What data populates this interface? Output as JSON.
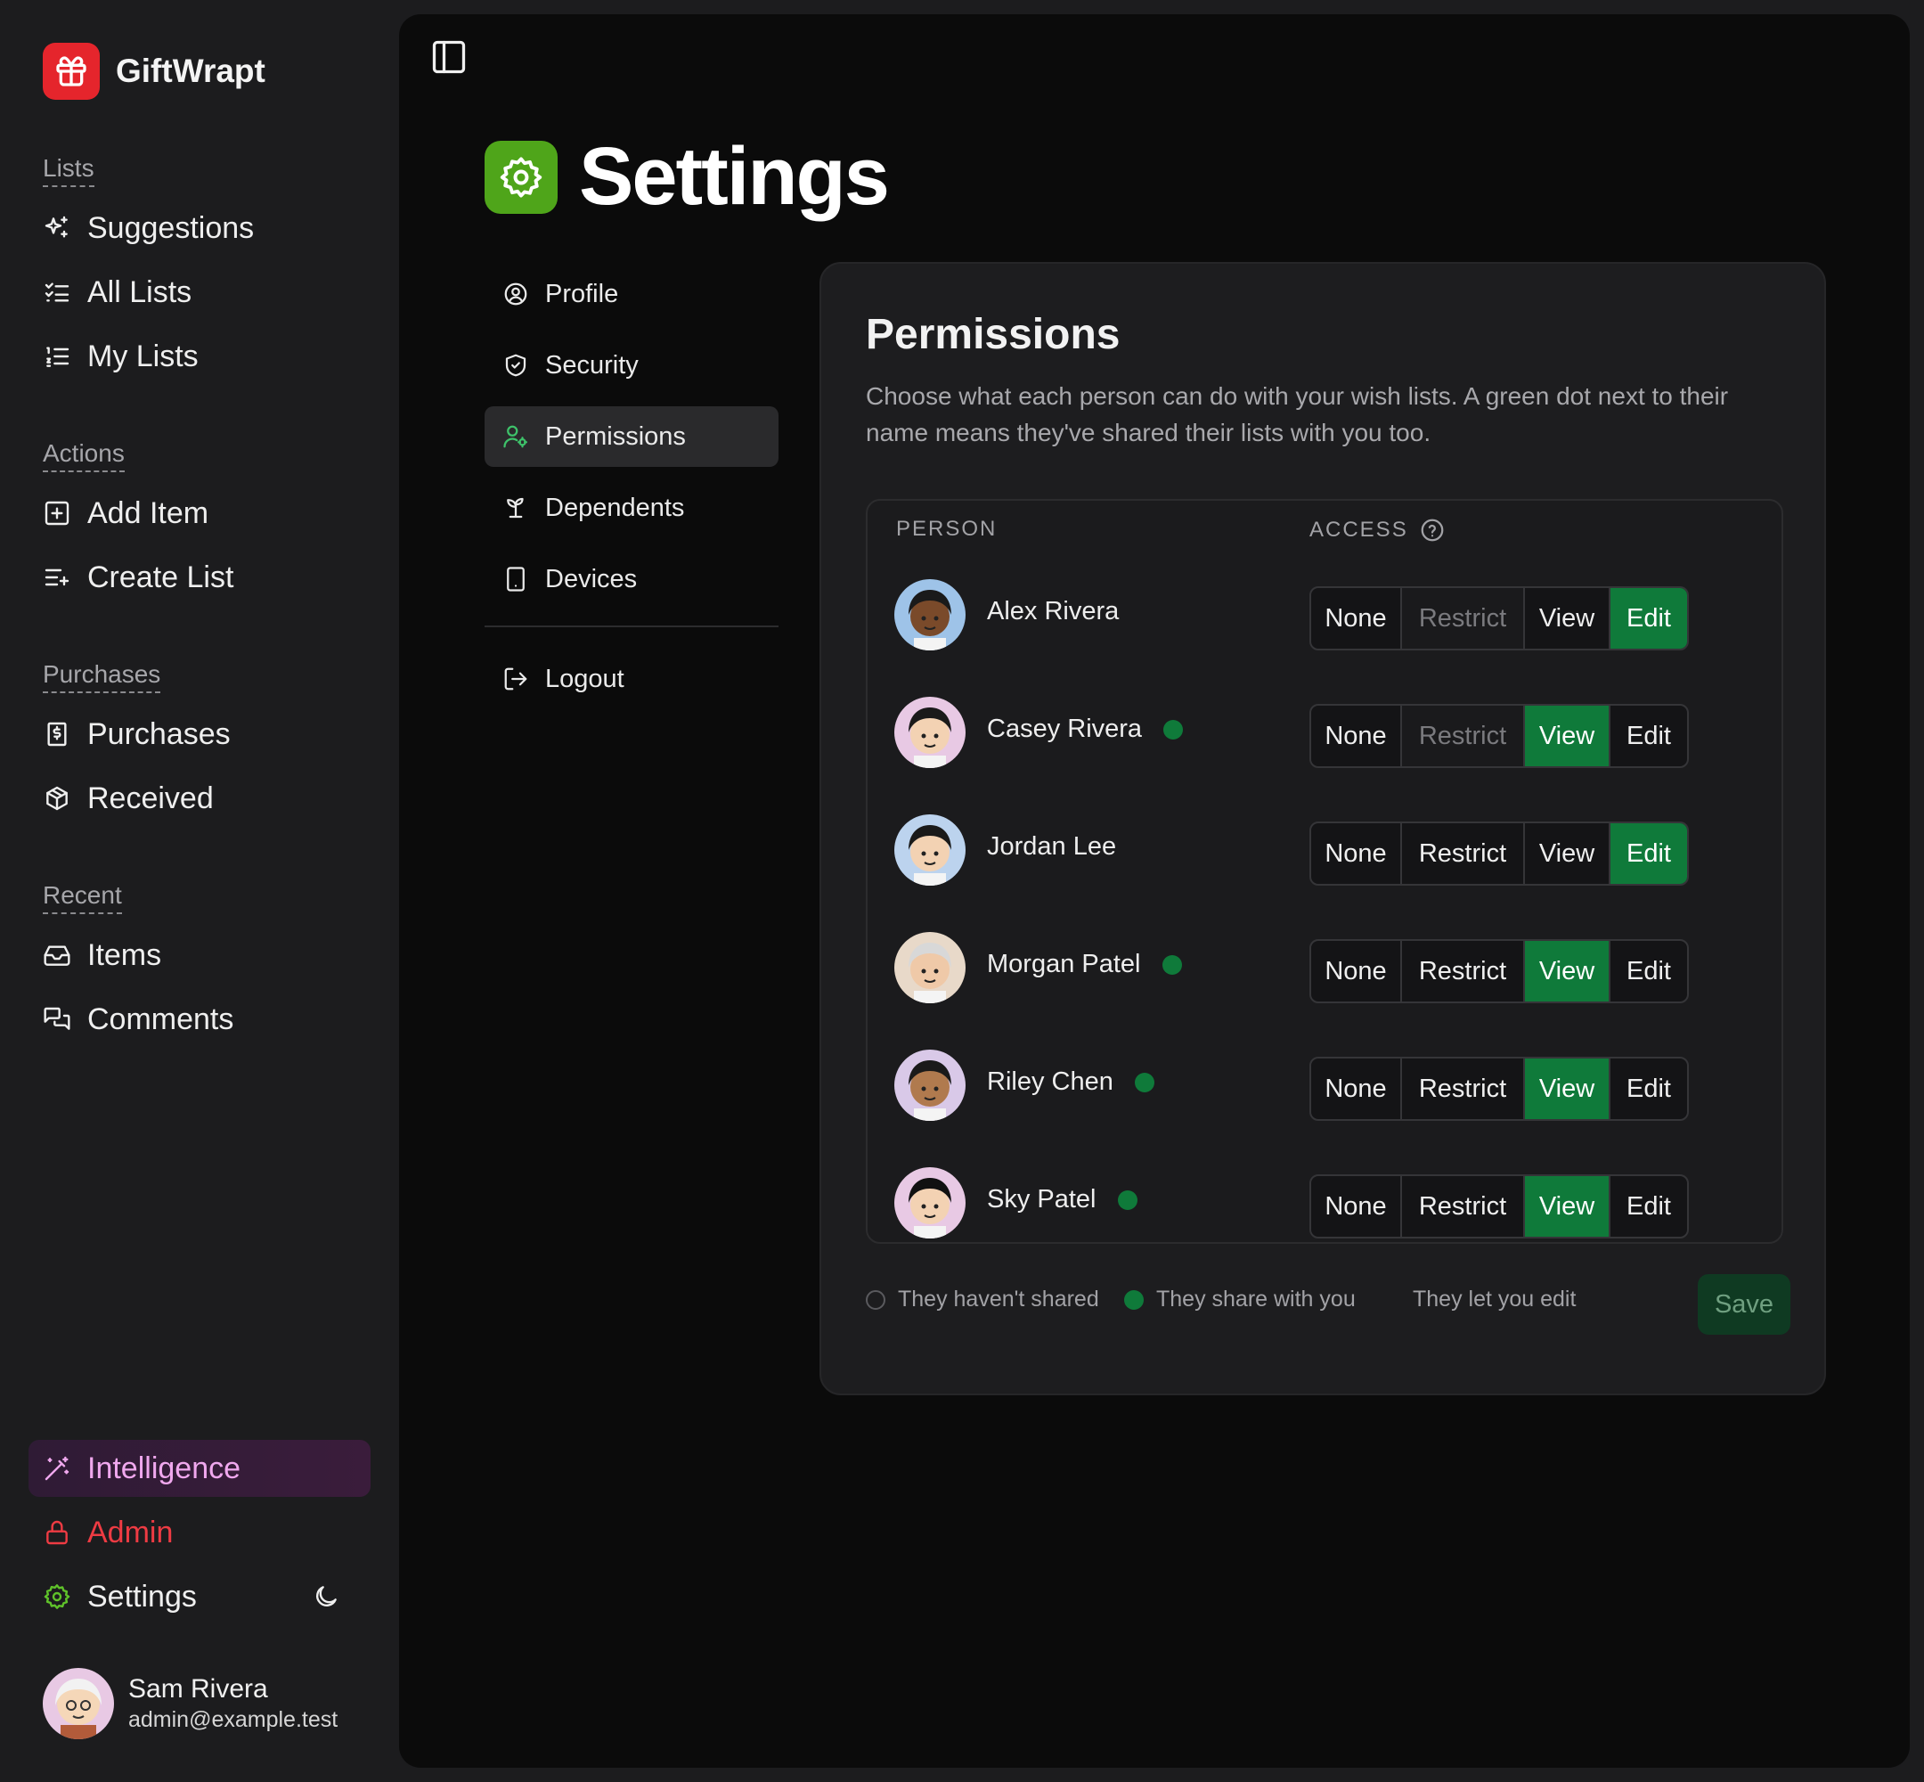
{
  "app": {
    "name": "GiftWrapt"
  },
  "sidebar": {
    "sections": [
      {
        "heading": "Lists",
        "items": [
          {
            "label": "Suggestions",
            "icon": "sparkles-icon"
          },
          {
            "label": "All Lists",
            "icon": "list-checks-icon"
          },
          {
            "label": "My Lists",
            "icon": "list-ordered-icon"
          }
        ]
      },
      {
        "heading": "Actions",
        "items": [
          {
            "label": "Add Item",
            "icon": "square-plus-icon"
          },
          {
            "label": "Create List",
            "icon": "list-plus-icon"
          }
        ]
      },
      {
        "heading": "Purchases",
        "items": [
          {
            "label": "Purchases",
            "icon": "receipt-icon"
          },
          {
            "label": "Received",
            "icon": "package-icon"
          }
        ]
      },
      {
        "heading": "Recent",
        "items": [
          {
            "label": "Items",
            "icon": "inbox-icon"
          },
          {
            "label": "Comments",
            "icon": "messages-icon"
          }
        ]
      }
    ],
    "bottom": {
      "intelligence": "Intelligence",
      "admin": "Admin",
      "settings": "Settings"
    },
    "user": {
      "name": "Sam Rivera",
      "email": "admin@example.test"
    }
  },
  "page": {
    "title": "Settings"
  },
  "settings_nav": {
    "items": [
      {
        "label": "Profile",
        "icon": "user-circle-icon"
      },
      {
        "label": "Security",
        "icon": "shield-check-icon"
      },
      {
        "label": "Permissions",
        "icon": "user-cog-icon",
        "active": true
      },
      {
        "label": "Dependents",
        "icon": "sprout-icon"
      },
      {
        "label": "Devices",
        "icon": "tablet-icon"
      }
    ],
    "logout": "Logout"
  },
  "permissions": {
    "title": "Permissions",
    "description": "Choose what each person can do with your wish lists. A green dot next to their name means they've shared their lists with you too.",
    "columns": {
      "person": "PERSON",
      "access": "ACCESS"
    },
    "access_options": [
      "None",
      "Restrict",
      "View",
      "Edit"
    ],
    "rows": [
      {
        "name": "Alex Rivera",
        "shared": false,
        "access": "Edit",
        "restrict_disabled": true
      },
      {
        "name": "Casey Rivera",
        "shared": true,
        "access": "View",
        "restrict_disabled": true
      },
      {
        "name": "Jordan Lee",
        "shared": false,
        "access": "Edit",
        "restrict_disabled": false
      },
      {
        "name": "Morgan Patel",
        "shared": true,
        "access": "View",
        "restrict_disabled": false
      },
      {
        "name": "Riley Chen",
        "shared": true,
        "access": "View",
        "restrict_disabled": false
      },
      {
        "name": "Sky Patel",
        "shared": true,
        "access": "View",
        "restrict_disabled": false
      }
    ],
    "legend": {
      "not_shared": "They haven't shared",
      "shared": "They share with you",
      "edit": "They let you edit"
    },
    "save_label": "Save"
  },
  "colors": {
    "brand": "#e5252c",
    "settings_icon": "#4fa51a",
    "active_green": "#0f7a3a",
    "admin_red": "#ee3b43",
    "intelligence_pink": "#f0a8ee"
  }
}
